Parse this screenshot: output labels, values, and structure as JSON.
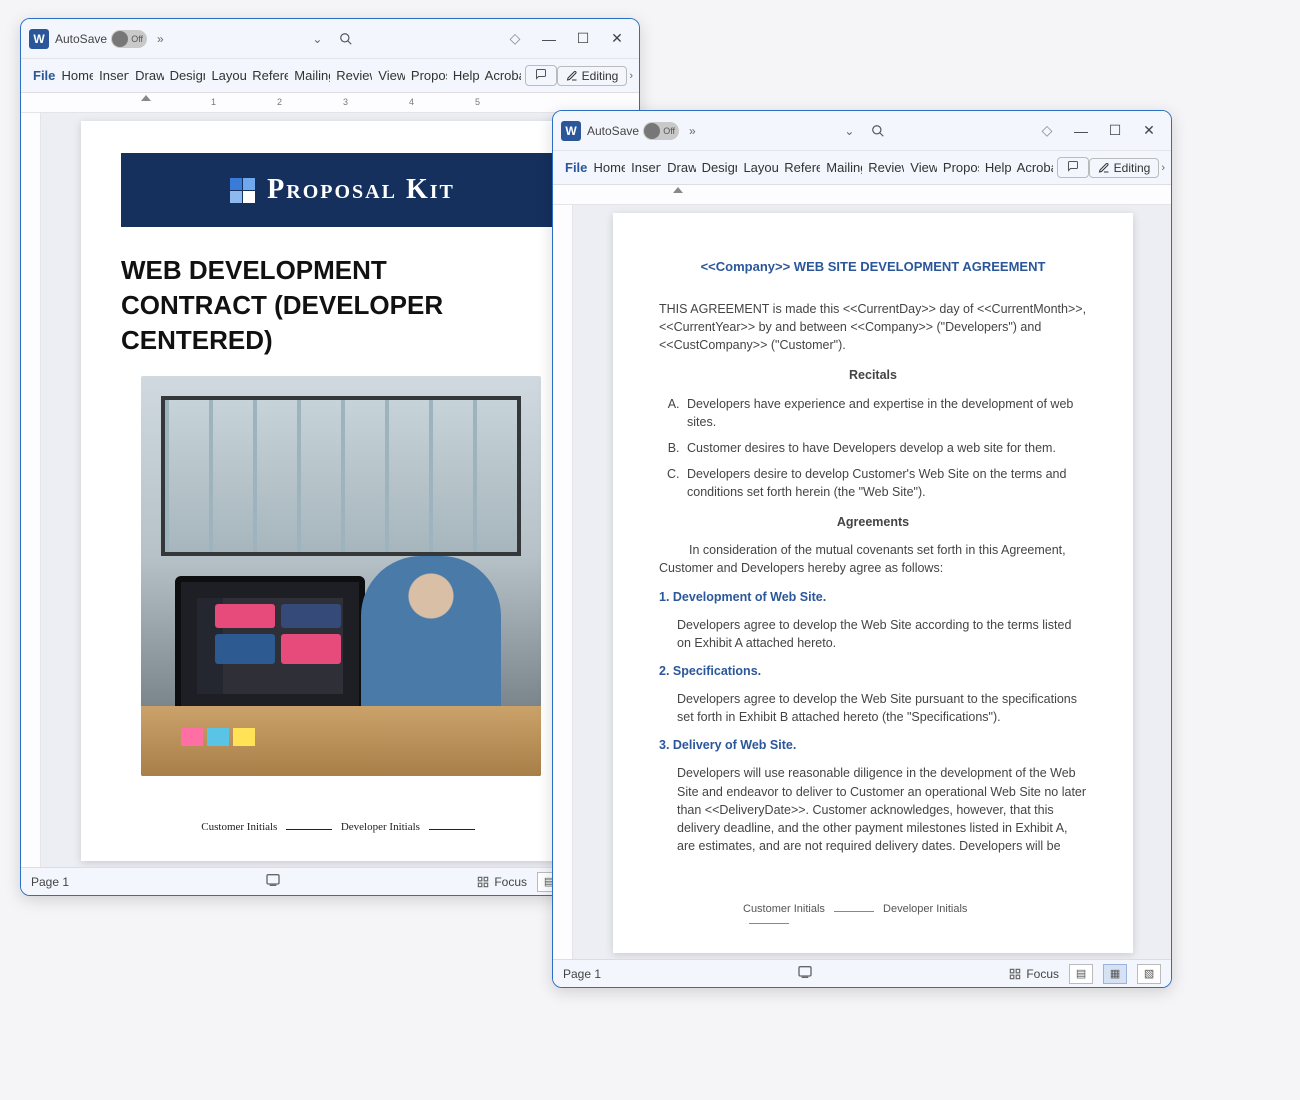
{
  "common": {
    "autosave_label": "AutoSave",
    "autosave_state": "Off",
    "editing_label": "Editing",
    "word_glyph": "W",
    "menu": [
      "File",
      "Home",
      "Insert",
      "Draw",
      "Design",
      "Layout",
      "References",
      "Mailings",
      "Review",
      "View",
      "Proposal",
      "Help",
      "Acrobat"
    ],
    "ruler_numbers": [
      "1",
      "2",
      "3",
      "4",
      "5"
    ],
    "focus_label": "Focus",
    "page_label": "Page 1"
  },
  "doc1": {
    "banner_brand": "Proposal Kit",
    "title": "WEB DEVELOPMENT CONTRACT (DEVELOPER CENTERED)",
    "cust_initials_label": "Customer Initials",
    "dev_initials_label": "Developer Initials"
  },
  "doc2": {
    "title": "<<Company>> WEB SITE DEVELOPMENT AGREEMENT",
    "intro": "THIS AGREEMENT is made this <<CurrentDay>> day of <<CurrentMonth>>, <<CurrentYear>> by and between <<Company>> (\"Developers\") and <<CustCompany>> (\"Customer\").",
    "recitals_head": "Recitals",
    "recitals": [
      "Developers have experience and expertise in the development of web sites.",
      "Customer desires to have Developers develop a web site for them.",
      "Developers desire to develop Customer's Web Site on the terms and conditions set forth herein (the \"Web Site\")."
    ],
    "agreements_head": "Agreements",
    "agreements_intro": "In consideration of the mutual covenants set forth in this Agreement, Customer and Developers hereby agree as follows:",
    "sections": [
      {
        "head": "1. Development of Web Site.",
        "body": "Developers agree to develop the Web Site according to the terms listed on Exhibit A attached hereto."
      },
      {
        "head": "2. Specifications.",
        "body": "Developers agree to develop the Web Site pursuant to the specifications set forth in Exhibit B attached hereto (the \"Specifications\")."
      },
      {
        "head": "3. Delivery of Web Site.",
        "body": "Developers will use reasonable diligence in the development of the Web Site and endeavor to deliver to Customer an operational Web Site no later than <<DeliveryDate>>.  Customer acknowledges, however, that this delivery deadline, and the other payment milestones listed in Exhibit A, are estimates, and are not required delivery dates. Developers will be"
      }
    ],
    "cust_initials_label": "Customer Initials",
    "dev_initials_label": "Developer Initials"
  }
}
